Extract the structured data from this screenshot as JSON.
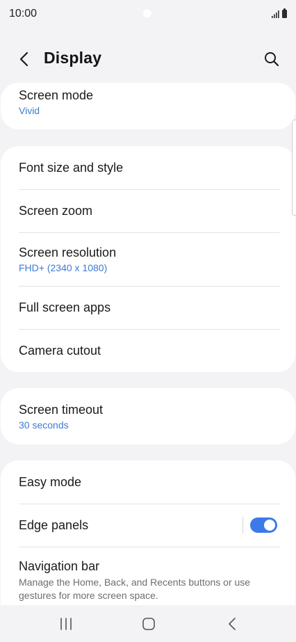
{
  "status_bar": {
    "time": "10:00"
  },
  "header": {
    "title": "Display"
  },
  "groups": [
    {
      "items": [
        {
          "title": "Screen mode",
          "subtitle": "Vivid"
        }
      ]
    },
    {
      "items": [
        {
          "title": "Font size and style"
        },
        {
          "title": "Screen zoom"
        },
        {
          "title": "Screen resolution",
          "subtitle": "FHD+ (2340 x 1080)"
        },
        {
          "title": "Full screen apps"
        },
        {
          "title": "Camera cutout"
        }
      ]
    },
    {
      "items": [
        {
          "title": "Screen timeout",
          "subtitle": "30 seconds"
        }
      ]
    },
    {
      "items": [
        {
          "title": "Easy mode"
        },
        {
          "title": "Edge panels",
          "toggle_on": true
        },
        {
          "title": "Navigation bar",
          "description": "Manage the Home, Back, and Recents buttons or use gestures for more screen space."
        }
      ]
    }
  ],
  "colors": {
    "accent": "#3a7bd5",
    "toggle": "#3b7ae8",
    "background": "#f3f3f5"
  }
}
